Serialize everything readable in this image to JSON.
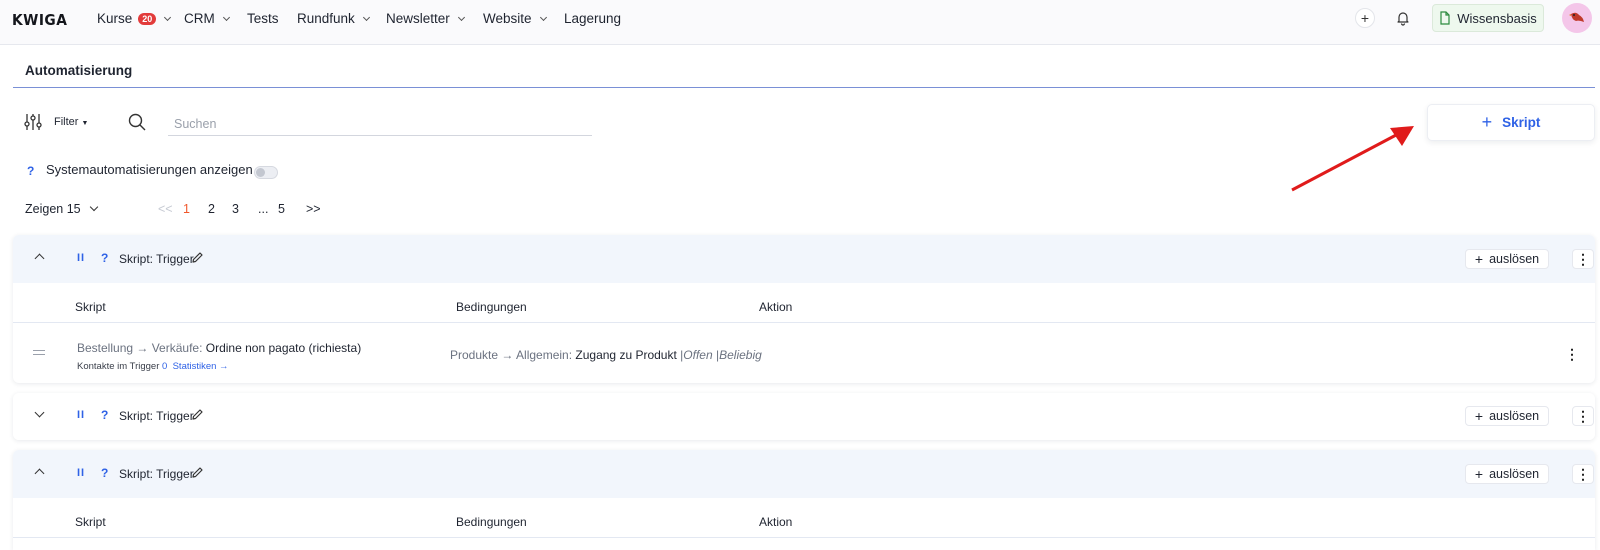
{
  "nav": {
    "logo": "KWIGA",
    "items": [
      {
        "label": "Kurse",
        "badge": "20",
        "dropdown": true
      },
      {
        "label": "CRM",
        "dropdown": true
      },
      {
        "label": "Tests",
        "dropdown": false
      },
      {
        "label": "Rundfunk",
        "dropdown": true
      },
      {
        "label": "Newsletter",
        "dropdown": true
      },
      {
        "label": "Website",
        "dropdown": true
      },
      {
        "label": "Lagerung",
        "dropdown": false
      }
    ],
    "add_symbol": "+",
    "knowledge_base": "Wissensbasis"
  },
  "page": {
    "title": "Automatisierung"
  },
  "toolbar": {
    "filter_label": "Filter",
    "search_placeholder": "Suchen",
    "add_script_label": "Skript",
    "add_symbol": "+"
  },
  "system": {
    "help": "?",
    "label": "Systemautomatisierungen anzeigen",
    "enabled": false
  },
  "pagination": {
    "show_label": "Zeigen 15",
    "first": "<<",
    "pages": [
      "1",
      "2",
      "3",
      "...",
      "5"
    ],
    "active_page": "1",
    "last": ">>"
  },
  "cards": [
    {
      "pause": "II",
      "help": "?",
      "title": "Skript: Trigger",
      "trigger_label": "auslösen",
      "trigger_symbol": "+",
      "menu": "⋮",
      "expanded": true,
      "columns": [
        "Skript",
        "Bedingungen",
        "Aktion"
      ],
      "row": {
        "script_prefix": "Bestellung → Verkäufe:",
        "script_name": "Ordine non pagato (richiesta)",
        "contacts_label": "Kontakte im Trigger",
        "contacts_count": "0",
        "stats_link": "Statistiken →",
        "condition_prefix": "Produkte → Allgemein:",
        "condition_name": "Zugang zu Produkt",
        "condition_sep1": "|",
        "condition_status": "Offen",
        "condition_sep2": "|",
        "condition_any": "Beliebig",
        "menu": "⋮"
      }
    },
    {
      "pause": "II",
      "help": "?",
      "title": "Skript: Trigger",
      "trigger_label": "auslösen",
      "trigger_symbol": "+",
      "menu": "⋮",
      "expanded": false
    },
    {
      "pause": "II",
      "help": "?",
      "title": "Skript: Trigger",
      "trigger_label": "auslösen",
      "trigger_symbol": "+",
      "menu": "⋮",
      "expanded": true,
      "columns": [
        "Skript",
        "Bedingungen",
        "Aktion"
      ]
    }
  ],
  "colors": {
    "accent": "#2f62e6",
    "active_page": "#f0582c",
    "badge": "#e23b3b",
    "annotation_arrow": "#e01b1b",
    "card_header": "#f2f6fc"
  }
}
